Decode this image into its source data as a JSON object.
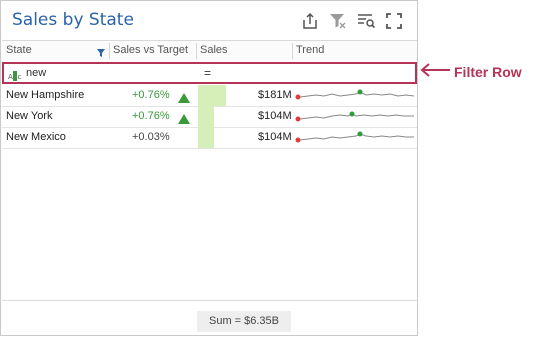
{
  "dashboard": {
    "title": "Sales by State",
    "toolbar": [
      "export-icon",
      "clear-filter-icon",
      "filter-options-icon",
      "maximize-icon"
    ]
  },
  "grid": {
    "columns": [
      "State",
      "Sales vs Target",
      "Sales",
      "Trend"
    ],
    "filter_row": {
      "value": "new",
      "operator": "="
    },
    "rows": [
      {
        "state": "New Hampshire",
        "vs_target": "+0.76%",
        "trend_up": true,
        "sales": "$181M",
        "bar_fraction": 1.0
      },
      {
        "state": "New York",
        "vs_target": "+0.76%",
        "trend_up": true,
        "sales": "$104M",
        "bar_fraction": 0.57
      },
      {
        "state": "New Mexico",
        "vs_target": "+0.03%",
        "trend_up": false,
        "sales": "$104M",
        "bar_fraction": 0.57
      }
    ],
    "total": "Sum = $6.35B"
  },
  "annotation": {
    "label": "Filter Row"
  },
  "colors": {
    "accent": "#2a63a8",
    "highlight": "#b53357",
    "positive": "#3a9a3a",
    "bar": "#d6efb8"
  }
}
